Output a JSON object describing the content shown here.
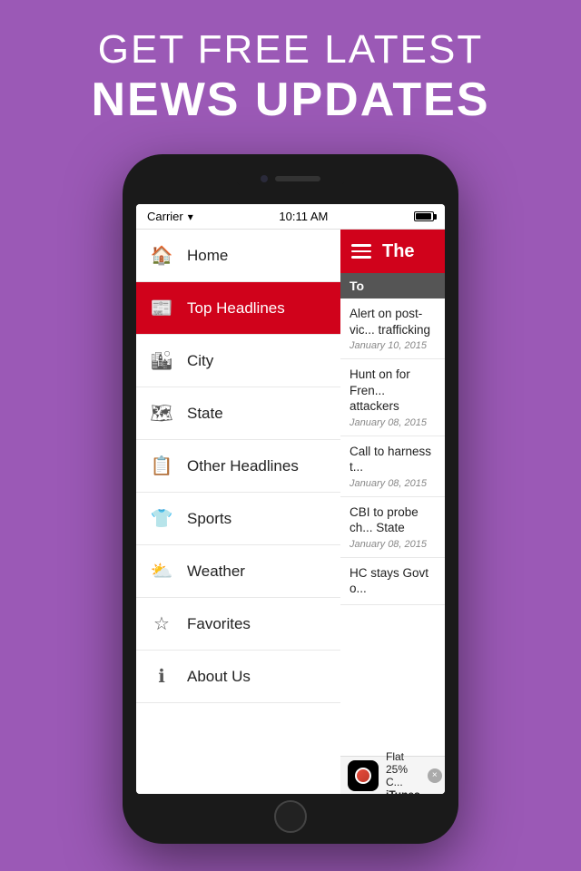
{
  "page": {
    "background_color": "#9b59b6",
    "header": {
      "line1": "GET FREE LATEST",
      "line2": "NEWS UPDATES"
    }
  },
  "status_bar": {
    "carrier": "Carrier",
    "time": "10:11 AM"
  },
  "app": {
    "title": "The",
    "hamburger_label": "menu"
  },
  "menu": {
    "items": [
      {
        "id": "home",
        "label": "Home",
        "icon": "🏠",
        "active": false
      },
      {
        "id": "top-headlines",
        "label": "Top Headlines",
        "icon": "📰",
        "active": true
      },
      {
        "id": "city",
        "label": "City",
        "icon": "🏙",
        "active": false
      },
      {
        "id": "state",
        "label": "State",
        "icon": "🗺",
        "active": false
      },
      {
        "id": "other-headlines",
        "label": "Other Headlines",
        "icon": "📋",
        "active": false
      },
      {
        "id": "sports",
        "label": "Sports",
        "icon": "👕",
        "active": false
      },
      {
        "id": "weather",
        "label": "Weather",
        "icon": "⛅",
        "active": false
      },
      {
        "id": "favorites",
        "label": "Favorites",
        "icon": "☆",
        "active": false
      },
      {
        "id": "about-us",
        "label": "About Us",
        "icon": "ℹ",
        "active": false
      }
    ]
  },
  "content": {
    "section_title": "To",
    "news": [
      {
        "headline": "Alert on post-vic... trafficking",
        "date": "January 10, 2015"
      },
      {
        "headline": "Hunt on for Fren... attackers",
        "date": "January 08, 2015"
      },
      {
        "headline": "Call to harness t...",
        "date": "January 08, 2015"
      },
      {
        "headline": "CBI to probe ch... State",
        "date": "January 08, 2015"
      },
      {
        "headline": "HC stays Govt o...",
        "date": ""
      }
    ]
  },
  "itunes_banner": {
    "text": "Flat 25% C...",
    "label": "iTunes",
    "close": "×"
  }
}
